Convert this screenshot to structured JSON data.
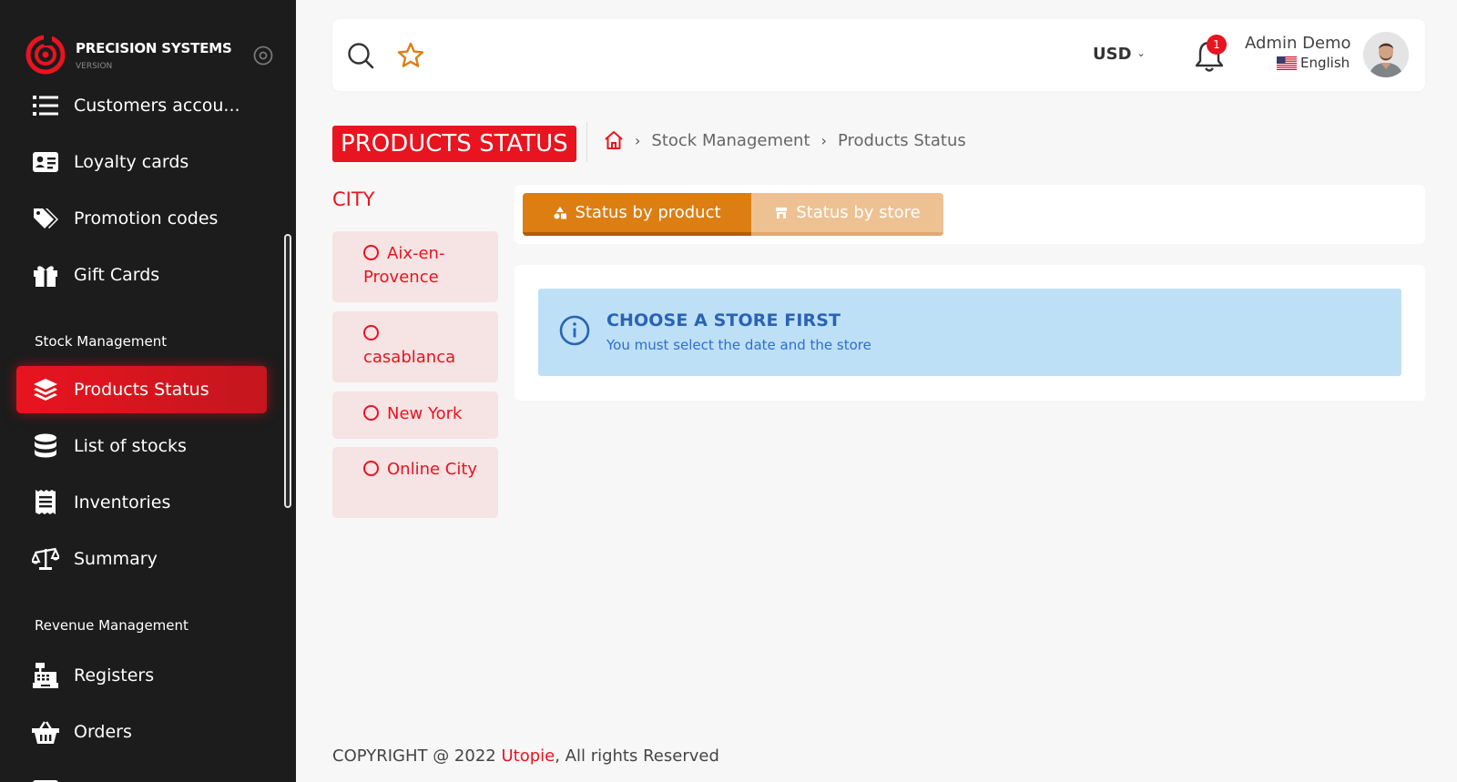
{
  "brand": {
    "name": "PRECISION SYSTEMS",
    "subtitle": "VERSION"
  },
  "sidebar": {
    "items": [
      {
        "label": "Customers accou...",
        "icon": "list-icon"
      },
      {
        "label": "Loyalty cards",
        "icon": "id-card-icon"
      },
      {
        "label": "Promotion codes",
        "icon": "tags-icon"
      },
      {
        "label": "Gift Cards",
        "icon": "gift-icon"
      },
      {
        "label": "Products Status",
        "icon": "layers-icon",
        "active": true
      },
      {
        "label": "List of stocks",
        "icon": "database-icon"
      },
      {
        "label": "Inventories",
        "icon": "receipt-icon"
      },
      {
        "label": "Summary",
        "icon": "scale-icon"
      },
      {
        "label": "Registers",
        "icon": "cash-register-icon"
      },
      {
        "label": "Orders",
        "icon": "basket-icon"
      }
    ],
    "sections": [
      "Stock Management",
      "Revenue Management"
    ]
  },
  "header": {
    "currency": "USD",
    "notification_count": "1",
    "user_name": "Admin Demo",
    "language": "English"
  },
  "page": {
    "title": "PRODUCTS STATUS",
    "breadcrumb": [
      "Stock Management",
      "Products Status"
    ]
  },
  "city_filter": {
    "title": "CITY",
    "cities": [
      "Aix-en-Provence",
      "casablanca",
      "New York",
      "Online City"
    ]
  },
  "tabs": [
    "Status by product",
    "Status by store"
  ],
  "alert": {
    "title": "CHOOSE A STORE FIRST",
    "message": "You must select the date and the store"
  },
  "footer": {
    "prefix": "COPYRIGHT @ 2022 ",
    "brand": "Utopie",
    "suffix": ", All rights Reserved"
  },
  "colors": {
    "accent": "#e8141f",
    "sidebar_bg": "#1c1c1c",
    "tab_active": "#dd7e12",
    "tab_inactive": "#eec193",
    "alert_bg": "#bde0f6",
    "alert_text": "#2a63b6"
  }
}
